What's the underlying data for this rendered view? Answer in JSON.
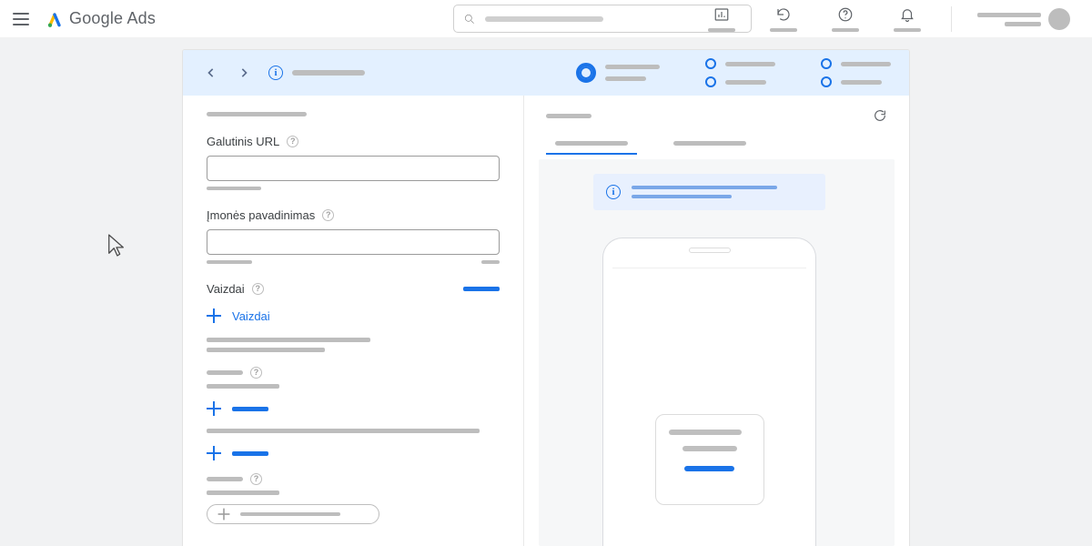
{
  "brand": {
    "name1": "Google",
    "name2": "Ads"
  },
  "form": {
    "final_url_label": "Galutinis URL",
    "business_name_label": "Įmonės pavadinimas",
    "images_label": "Vaizdai",
    "add_images_label": "Vaizdai"
  },
  "colors": {
    "blue": "#1a73e8"
  }
}
